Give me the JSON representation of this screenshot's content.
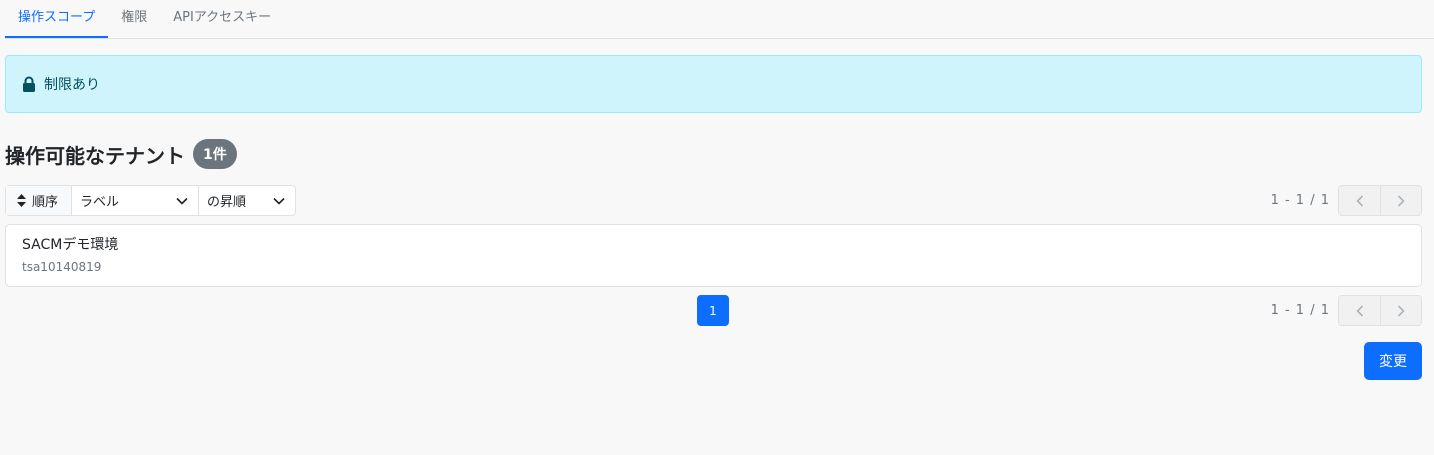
{
  "tabs": [
    {
      "label": "操作スコープ",
      "active": true
    },
    {
      "label": "権限",
      "active": false
    },
    {
      "label": "APIアクセスキー",
      "active": false
    }
  ],
  "alert": {
    "icon": "lock-icon",
    "text": "制限あり"
  },
  "section": {
    "title": "操作可能なテナント",
    "count_badge": "1件"
  },
  "sort": {
    "label": "順序",
    "field_selected": "ラベル",
    "direction_selected": "の昇順"
  },
  "pagination": {
    "range_text": "1 - 1 / 1",
    "current_page": "1"
  },
  "tenants": [
    {
      "name": "SACMデモ環境",
      "id": "tsa10140819"
    }
  ],
  "actions": {
    "submit_label": "変更"
  },
  "colors": {
    "primary": "#0d6efd",
    "alert_bg": "#cff4fc",
    "alert_text": "#055160",
    "badge_bg": "#6c757d"
  }
}
